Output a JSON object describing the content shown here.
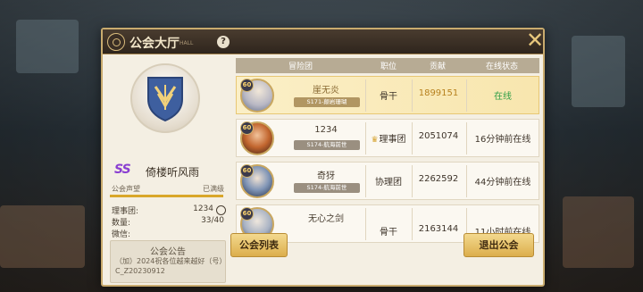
{
  "window": {
    "title": "公会大厅",
    "title_sub": "HALL",
    "help": "?",
    "close": "✕"
  },
  "guild": {
    "tier": "SS",
    "name": "倚楼听风雨",
    "reputation_label": "公会声望",
    "reputation_value": "已满级",
    "reputation_fill": 1.0,
    "stats": [
      {
        "key": "理事团:",
        "value": "1234"
      },
      {
        "key": "数量:",
        "value": "33/40"
      },
      {
        "key": "微信:",
        "value": ""
      }
    ],
    "notice_title": "公会公告",
    "notice_body": "（加）2024祝各位越来越好（号）C_Z20230912"
  },
  "table": {
    "headers": [
      "冒险团",
      "职位",
      "贡献",
      "在线状态"
    ],
    "rows": [
      {
        "level": "60",
        "name": "崖无炎",
        "server": "S171-颠岩珊瑚",
        "role": "骨干",
        "contribution": "1899151",
        "status": "在线",
        "highlight": true
      },
      {
        "level": "60",
        "name": "1234",
        "server": "S174-航海前世",
        "role": "理事团",
        "contribution": "2051074",
        "status": "16分钟前在线",
        "crown": true
      },
      {
        "level": "60",
        "name": "奇犽",
        "server": "S174-航海前世",
        "role": "协理团",
        "contribution": "2262592",
        "status": "44分钟前在线"
      },
      {
        "level": "60",
        "name": "无心之剑",
        "server": "",
        "role": "骨干",
        "contribution": "2163144",
        "status": "11小时前在线"
      }
    ]
  },
  "buttons": {
    "guild_list": "公会列表",
    "leave_guild": "退出公会"
  },
  "colors": {
    "accent_gold": "#dcae4c",
    "online_green": "#2f9e47",
    "tier_purple": "#8a3fd1"
  }
}
